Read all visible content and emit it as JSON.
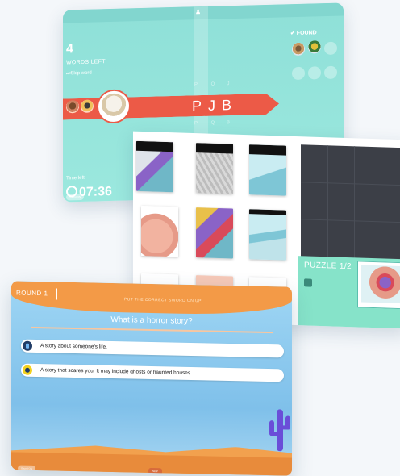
{
  "word_game": {
    "top_icon": "person-icon",
    "words_left_count": "4",
    "words_left_label": "WORDS LEFT",
    "skip_word_label": "Skip word",
    "found_label": "✔ FOUND",
    "letters": "PJB",
    "upper_letters": [
      "P",
      "Q",
      "J"
    ],
    "lower_letters": [
      "P",
      "Q",
      "B"
    ],
    "time_left_label": "Time left",
    "timer": "07:36",
    "sound_label": "Sound ON"
  },
  "puzzle": {
    "label": "PUZZLE 1/2",
    "tiles": [
      "ear-piece-1",
      "ear-piece-2",
      "ear-piece-3",
      "ear-piece-4",
      "ear-piece-5",
      "ear-piece-6",
      "ear-piece-7",
      "ear-piece-8",
      "ear-piece-9"
    ]
  },
  "quiz": {
    "round_label": "ROUND 1",
    "instruction": "PUT THE CORRECT SWORD ON UP",
    "question": "What is a horror story?",
    "answers": [
      "A story about someone's life.",
      "A story that scares you. It may include ghosts or haunted houses."
    ],
    "sound_label": "Sound ON",
    "skip_label": "SKIP"
  },
  "colors": {
    "word_bg": "#9be8de",
    "banner": "#ec5a47",
    "puzzle_accent": "#86e3c9",
    "quiz_header": "#f39a47",
    "quiz_bg": "#7fc0ea"
  }
}
